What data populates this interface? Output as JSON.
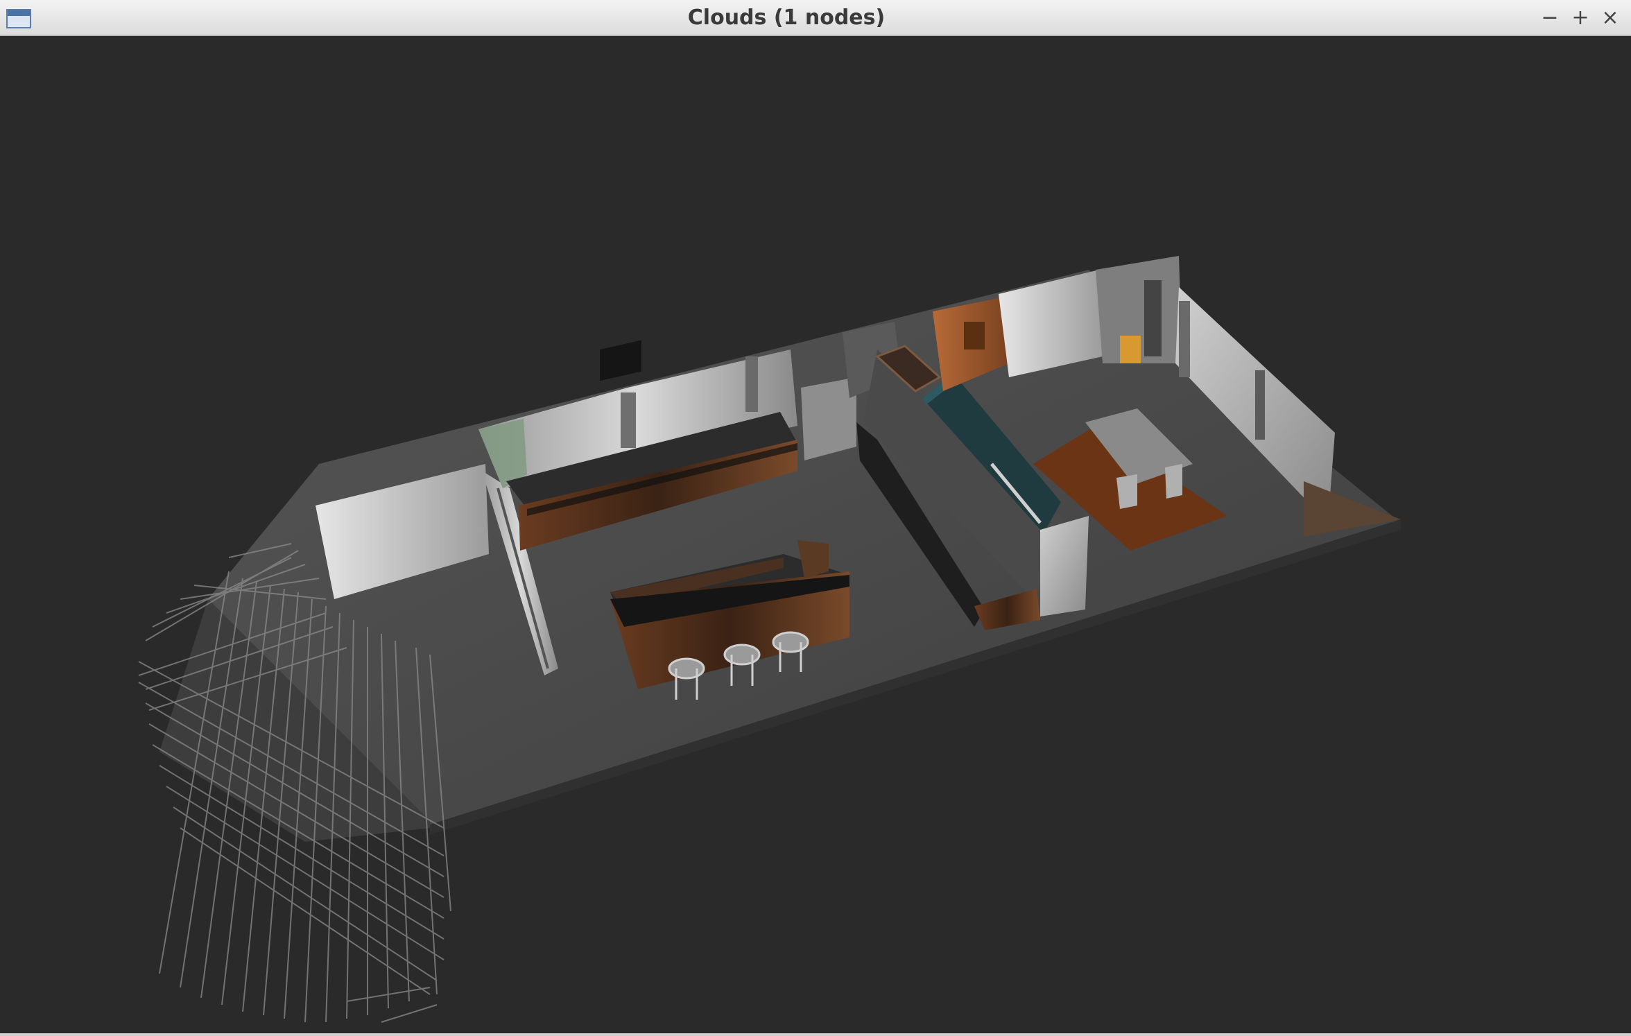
{
  "window": {
    "title": "Clouds (1 nodes)",
    "controls": {
      "minimize": "−",
      "maximize": "+",
      "close": "×"
    }
  },
  "viewport": {
    "background": "#2a2a2a",
    "scene": "3D point cloud of an indoor apartment"
  },
  "colors": {
    "floor": "#4a4a4a",
    "walls": "#c8c8c8",
    "wood": "#5a3520",
    "rug": "#6b3414",
    "teal": "#1f3b40",
    "scan_lines": "#8a8a8a"
  }
}
